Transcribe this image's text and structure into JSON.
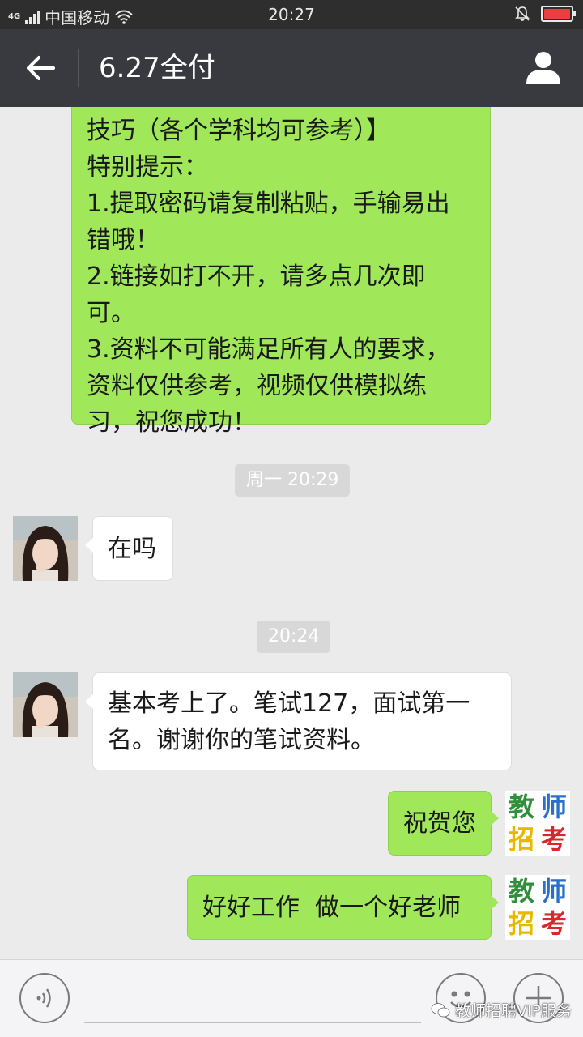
{
  "status_bar": {
    "network_type": "4G",
    "carrier": "中国移动",
    "time": "20:27"
  },
  "title_bar": {
    "title": "6.27全付",
    "icons": [
      "back-arrow-icon",
      "contact-info-icon"
    ]
  },
  "messages": [
    {
      "side": "right",
      "sender_avatar": "logo",
      "lines": [
        "技巧（各个学科均可参考）】",
        "特别提示：",
        "1.提取密码请复制粘贴，手输易出",
        "错哦！",
        "2.链接如打不开，请多点几次即",
        "可。",
        "3.资料不可能满足所有人的要求，",
        "资料仅供参考，视频仅供模拟练",
        "习，祝您成功！"
      ]
    },
    {
      "type": "timestamp",
      "text": "周一 20:29"
    },
    {
      "side": "left",
      "sender_avatar": "girl-photo",
      "lines": [
        "在吗"
      ]
    },
    {
      "type": "timestamp",
      "text": "20:24"
    },
    {
      "side": "left",
      "sender_avatar": "girl-photo",
      "lines": [
        "基本考上了。笔试127，面试第一",
        "名。谢谢你的笔试资料。"
      ]
    },
    {
      "side": "right",
      "sender_avatar": "logo",
      "lines": [
        "祝贺您"
      ]
    },
    {
      "side": "right",
      "sender_avatar": "logo",
      "lines": [
        "好好工作  做一个好老师"
      ]
    }
  ],
  "logo": {
    "chars": [
      "教",
      "师",
      "招",
      "考"
    ],
    "colors": [
      "#2f8f3a",
      "#2a6fc9",
      "#e8b800",
      "#d42a2a"
    ]
  },
  "input_bar": {
    "icons": [
      "voice-icon",
      "emoji-icon",
      "plus-icon"
    ],
    "watermark": "教师招聘VIP服务"
  },
  "colors": {
    "bubble_green": "#a0e75a",
    "title_bar": "#393a3f",
    "status_bar": "#2e2e2e",
    "background": "#ebebeb"
  }
}
